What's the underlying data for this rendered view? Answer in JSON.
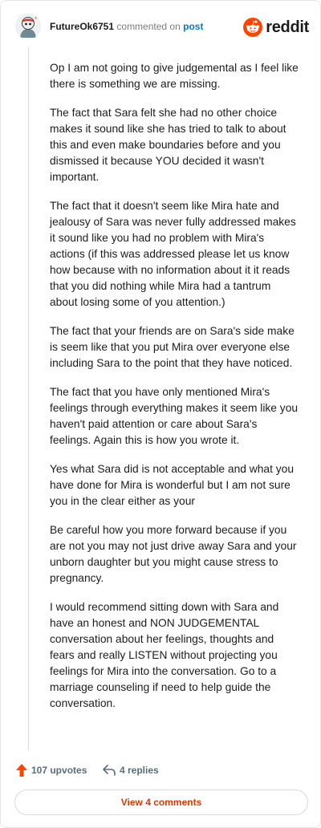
{
  "comment": {
    "author": "FutureOk6751",
    "commented_text": "commented on",
    "post_link": "post",
    "brand": "reddit",
    "paragraphs": [
      "Op I am not going to give judgemental as I feel like there is something we are missing.",
      "The fact that Sara felt she had no other choice makes it sound like she has tried to talk to about this and even make boundaries before and you dismissed it because YOU decided it wasn't important.",
      "The fact that it doesn't seem like Mira hate and jealousy of Sara was never fully addressed makes it sound like you had no problem with Mira's actions (if this was addressed please let us know how because with no information about it it reads that you did nothing while Mira had a tantrum about losing some of you attention.)",
      "The fact that your friends are on Sara's side make is seem like that you put Mira over everyone else including Sara to the point that they have noticed.",
      "The fact that you have only mentioned Mira's feelings through everything makes it seem like you haven't paid attention or care about Sara's feelings. Again this is how you wrote it.",
      "Yes what Sara did is not acceptable and what you have done for Mira is wonderful but I am not sure you in the clear either as your",
      "Be careful how you more forward because if you are not you may not just drive away Sara and your unborn daughter but you might cause stress to pregnancy.",
      "I would recommend sitting down with Sara and have an honest and NON JUDGEMENTAL conversation about her feelings, thoughts and fears and really LISTEN without projecting you feelings for Mira into the conversation. Go to a marriage counseling if need to help guide the conversation."
    ],
    "upvotes": "107 upvotes",
    "replies": "4 replies",
    "view_comments": "View 4 comments"
  },
  "colors": {
    "accent_orange": "#ff4500",
    "link_blue": "#0079d3",
    "view_button_text": "#d93a00",
    "muted": "#576f76"
  },
  "icons": [
    "avatar-icon",
    "reddit-logo-icon",
    "upvote-arrow-icon",
    "reply-arrow-icon"
  ]
}
